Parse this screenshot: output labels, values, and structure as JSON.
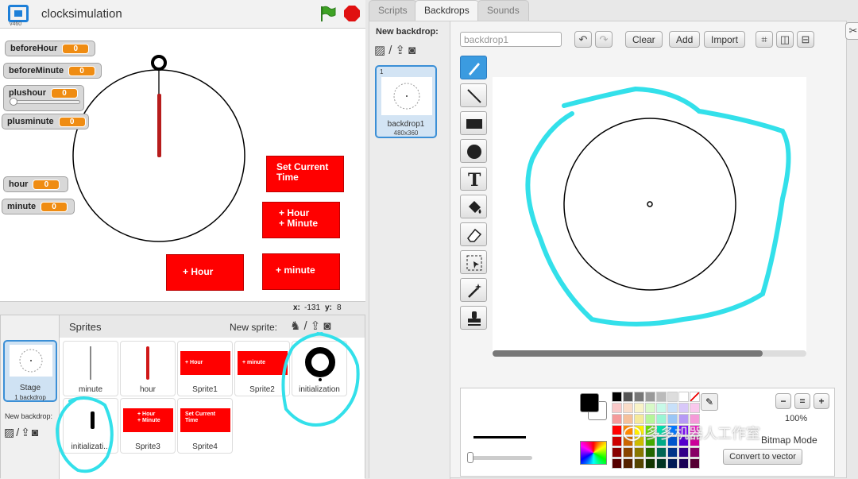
{
  "app": {
    "project_title": "clocksimulation",
    "version": "v460"
  },
  "stage": {
    "monitors": [
      {
        "label": "beforeHour",
        "value": "0"
      },
      {
        "label": "beforeMinute",
        "value": "0"
      },
      {
        "label": "plushour",
        "value": "0",
        "slider_level": 0
      },
      {
        "label": "plusminute",
        "value": "0"
      },
      {
        "label": "hour",
        "value": "0"
      },
      {
        "label": "minute",
        "value": "0"
      }
    ],
    "buttons": {
      "set_time": "Set Current\nTime",
      "hour_minute": "+ Hour\n+ Minute",
      "hour": "+ Hour",
      "minute": "+ minute"
    },
    "coords": {
      "x_label": "x:",
      "x_value": "-131",
      "y_label": "y:",
      "y_value": "8"
    }
  },
  "sprites_pane": {
    "title": "Sprites",
    "new_sprite_label": "New sprite:",
    "stage": {
      "name": "Stage",
      "sub": "1 backdrop"
    },
    "new_backdrop_label": "New backdrop:",
    "sprites": [
      {
        "name": "minute"
      },
      {
        "name": "hour"
      },
      {
        "name": "Sprite1",
        "thumb_text": "+ Hour"
      },
      {
        "name": "Sprite2",
        "thumb_text": "+ minute"
      },
      {
        "name": "initialization"
      },
      {
        "name": "initializati..."
      },
      {
        "name": "Sprite3",
        "thumb_text": "+ Hour\n+ Minute"
      },
      {
        "name": "Sprite4",
        "thumb_text": "Set Current\nTime"
      }
    ]
  },
  "editor": {
    "tabs": [
      {
        "label": "Scripts"
      },
      {
        "label": "Backdrops"
      },
      {
        "label": "Sounds"
      }
    ],
    "active_tab": "Backdrops",
    "new_backdrop_label": "New backdrop:",
    "backdrop": {
      "index": "1",
      "name": "backdrop1",
      "size": "480x360"
    },
    "name_input_value": "backdrop1",
    "toolbar": {
      "clear": "Clear",
      "add": "Add",
      "import": "Import"
    },
    "zoom_level": "100%",
    "mode_label": "Bitmap Mode",
    "convert_label": "Convert to vector",
    "accent_color": "#3b9be0"
  },
  "palette": [
    "#000000",
    "#555555",
    "#777777",
    "#999999",
    "#bbbbbb",
    "#dddddd",
    "#ffffff",
    "none",
    "#f9c8c8",
    "#f9dcc8",
    "#f9f3c8",
    "#d8f9c8",
    "#c8f9e8",
    "#c8e0f9",
    "#d8c8f9",
    "#f9c8ec",
    "#f59a9a",
    "#f5c09a",
    "#f5e99a",
    "#b6f59a",
    "#9af5d4",
    "#9ac6f5",
    "#b69af5",
    "#f59ad8",
    "#ff0000",
    "#ff8800",
    "#ffee00",
    "#66dd00",
    "#00ddaa",
    "#0077ff",
    "#7a00ff",
    "#ff00cc",
    "#cc0000",
    "#cc6600",
    "#ccbb00",
    "#44aa00",
    "#00aa88",
    "#0055cc",
    "#5500cc",
    "#cc0099",
    "#880000",
    "#884400",
    "#887700",
    "#226600",
    "#006655",
    "#003388",
    "#330088",
    "#880066",
    "#550000",
    "#552200",
    "#554400",
    "#113300",
    "#003322",
    "#001a55",
    "#1a0055",
    "#550033"
  ],
  "watermark": "多多机器人工作室",
  "annotation_color": "#33e0ea"
}
